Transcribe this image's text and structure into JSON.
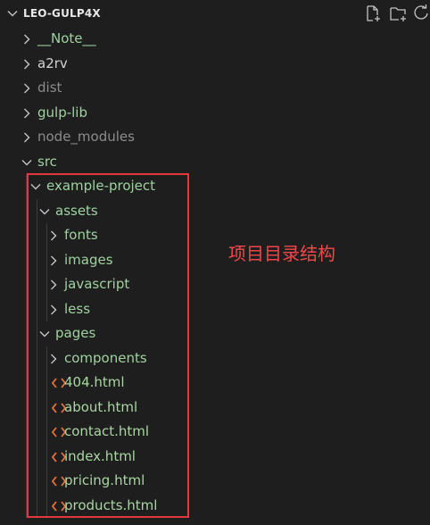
{
  "explorer": {
    "title": "LEO-GULP4X",
    "actions": [
      {
        "name": "new-file-icon"
      },
      {
        "name": "new-folder-icon"
      },
      {
        "name": "refresh-icon"
      }
    ]
  },
  "colors": {
    "background": "#1e1e1e",
    "folder_text": "#9fd2a0",
    "file_text": "#a9d6a2",
    "ignored_text": "#8c8c8c",
    "chevron": "#c5c5c5",
    "html_icon": "#e8703a",
    "highlight_border": "#e0393e",
    "annotation": "#f2474a"
  },
  "tree": [
    {
      "label": "__Note__",
      "type": "folder",
      "expanded": false,
      "depth": 1,
      "color": "#9fd2a0"
    },
    {
      "label": "a2rv",
      "type": "folder",
      "expanded": false,
      "depth": 1,
      "color": "#d4d4d4"
    },
    {
      "label": "dist",
      "type": "folder",
      "expanded": false,
      "depth": 1,
      "color": "#8c8c8c"
    },
    {
      "label": "gulp-lib",
      "type": "folder",
      "expanded": false,
      "depth": 1,
      "color": "#9fd2a0"
    },
    {
      "label": "node_modules",
      "type": "folder",
      "expanded": false,
      "depth": 1,
      "color": "#8c8c8c"
    },
    {
      "label": "src",
      "type": "folder",
      "expanded": true,
      "depth": 1,
      "color": "#9fd2a0"
    },
    {
      "label": "example-project",
      "type": "folder",
      "expanded": true,
      "depth": 2,
      "color": "#9fd2a0"
    },
    {
      "label": "assets",
      "type": "folder",
      "expanded": true,
      "depth": 3,
      "color": "#9fd2a0"
    },
    {
      "label": "fonts",
      "type": "folder",
      "expanded": false,
      "depth": 4,
      "color": "#9fd2a0"
    },
    {
      "label": "images",
      "type": "folder",
      "expanded": false,
      "depth": 4,
      "color": "#9fd2a0"
    },
    {
      "label": "javascript",
      "type": "folder",
      "expanded": false,
      "depth": 4,
      "color": "#9fd2a0"
    },
    {
      "label": "less",
      "type": "folder",
      "expanded": false,
      "depth": 4,
      "color": "#9fd2a0"
    },
    {
      "label": "pages",
      "type": "folder",
      "expanded": true,
      "depth": 3,
      "color": "#9fd2a0"
    },
    {
      "label": "components",
      "type": "folder",
      "expanded": false,
      "depth": 4,
      "color": "#9fd2a0"
    },
    {
      "label": "404.html",
      "type": "html",
      "depth": 4,
      "color": "#a9d6a2"
    },
    {
      "label": "about.html",
      "type": "html",
      "depth": 4,
      "color": "#a9d6a2"
    },
    {
      "label": "contact.html",
      "type": "html",
      "depth": 4,
      "color": "#a9d6a2"
    },
    {
      "label": "index.html",
      "type": "html",
      "depth": 4,
      "color": "#a9d6a2"
    },
    {
      "label": "pricing.html",
      "type": "html",
      "depth": 4,
      "color": "#a9d6a2"
    },
    {
      "label": "products.html",
      "type": "html",
      "depth": 4,
      "color": "#a9d6a2"
    }
  ],
  "annotation": {
    "text": "项目目录结构"
  }
}
